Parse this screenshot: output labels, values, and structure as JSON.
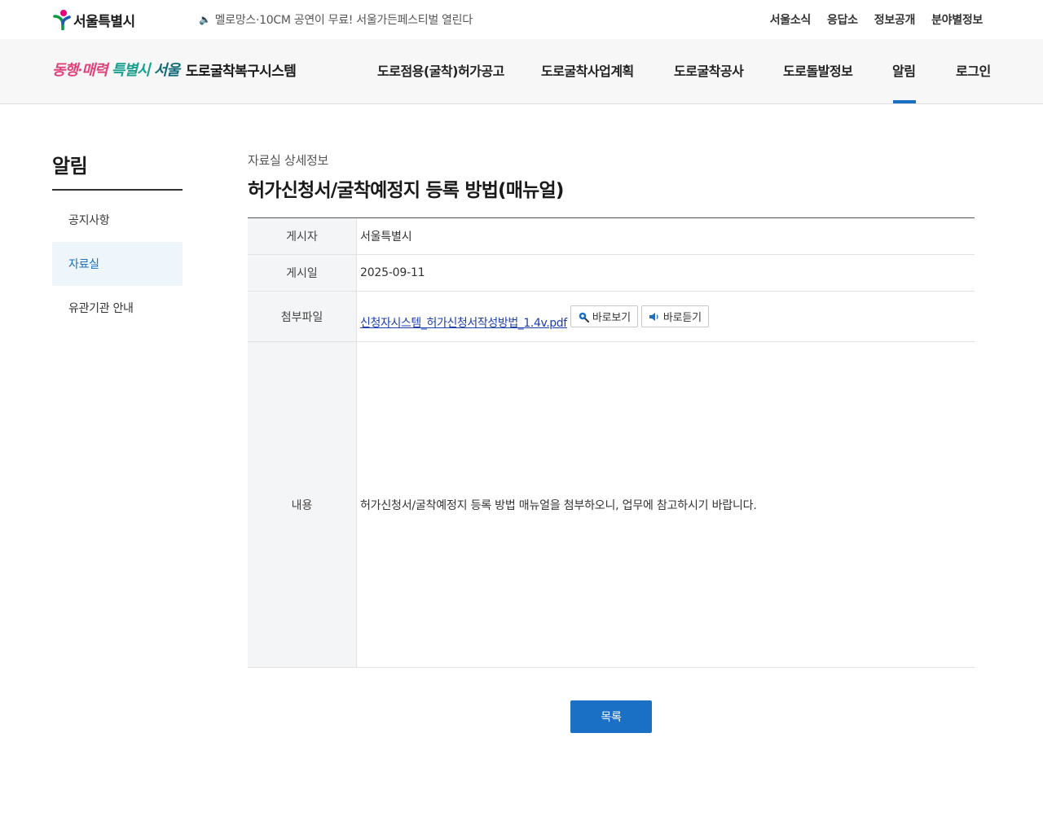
{
  "top": {
    "logo_text": "서울특별시",
    "news_text": "멜로망스·10CM 공연이 무료! 서울가든페스티벌 열린다",
    "util_links": [
      "서울소식",
      "응답소",
      "정보공개",
      "분야별정보"
    ]
  },
  "header": {
    "slogan_part1": "동행·매력",
    "slogan_part2": "특별시",
    "slogan_part3": "서울",
    "system_name": "도로굴착복구시스템",
    "nav": [
      "도로점용(굴착)허가공고",
      "도로굴착사업계획",
      "도로굴착공사",
      "도로돌발정보",
      "알림",
      "로그인"
    ],
    "active_nav": "알림"
  },
  "sidebar": {
    "title": "알림",
    "items": [
      "공지사항",
      "자료실",
      "유관기관 안내"
    ],
    "active_item": "자료실"
  },
  "content": {
    "breadcrumb": "자료실 상세정보",
    "title": "허가신청서/굴착예정지 등록 방법(매뉴얼)",
    "rows": {
      "author_label": "게시자",
      "author_value": "서울특별시",
      "date_label": "게시일",
      "date_value": "2025-09-11",
      "attach_label": "첨부파일",
      "attach_file": "신청자시스템_허가신청서작성방법_1.4v.pdf",
      "view_button": "바로보기",
      "listen_button": "바로듣기",
      "body_label": "내용",
      "body_value": "허가신청서/굴착예정지 등록 방법 매뉴얼을 첨부하오니, 업무에 참고하시기 바랍니다."
    },
    "list_button": "목록"
  },
  "colors": {
    "accent": "#1a70c4",
    "link": "#1d3fae",
    "active_bg": "#eef6fc"
  }
}
